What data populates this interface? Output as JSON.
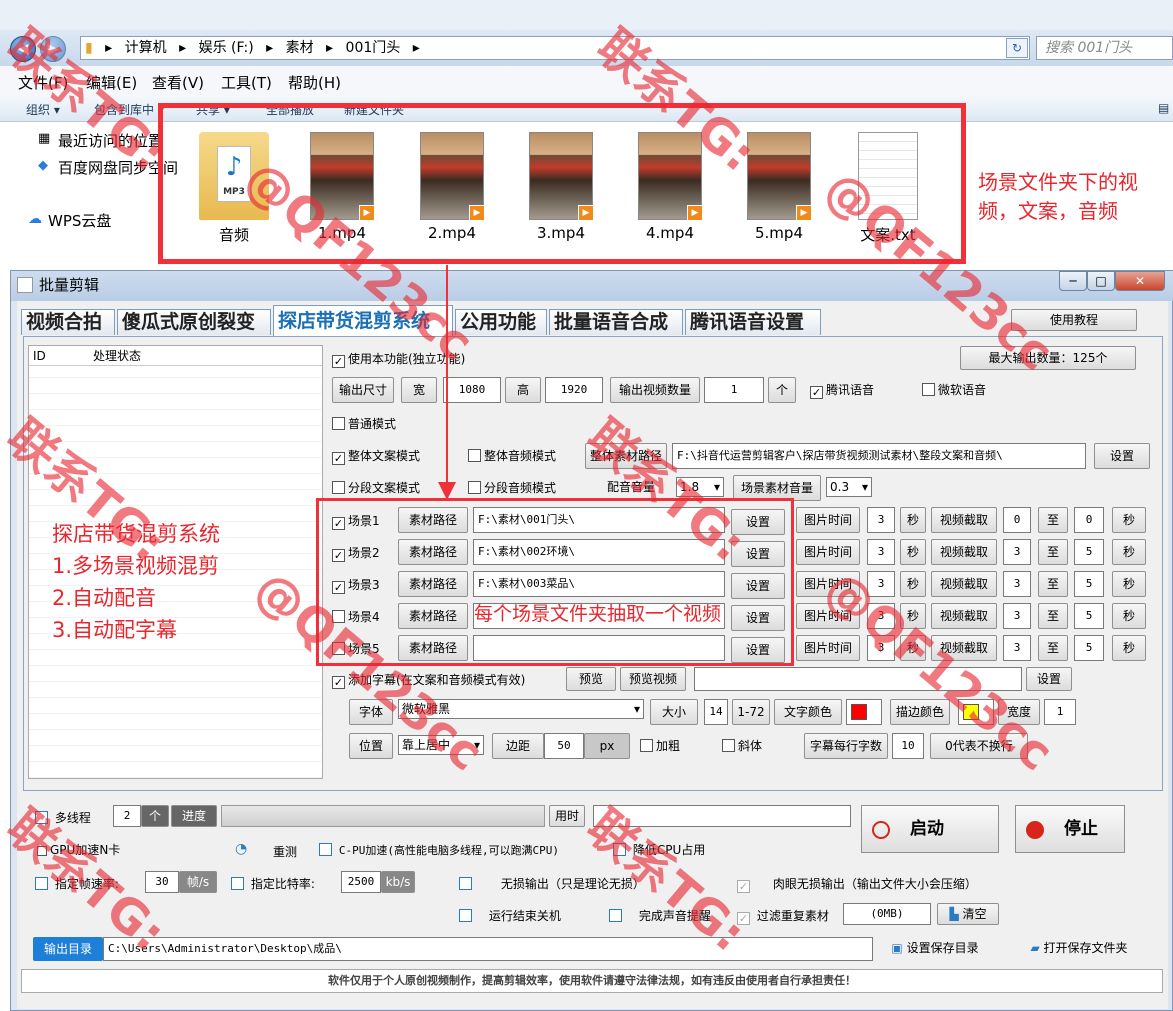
{
  "explorer": {
    "path": [
      "计算机",
      "娱乐 (F:)",
      "素材",
      "001门头"
    ],
    "search_placeholder": "搜索 001门头",
    "menu": [
      "文件(F)",
      "编辑(E)",
      "查看(V)",
      "工具(T)",
      "帮助(H)"
    ],
    "commands": [
      "组织 ▾",
      "包含到库中 ▾",
      "共享 ▾",
      "全部播放",
      "新建文件夹"
    ],
    "nav": [
      "最近访问的位置",
      "百度网盘同步空间",
      "WPS云盘"
    ],
    "files": [
      "音频",
      "1.mp4",
      "2.mp4",
      "3.mp4",
      "4.mp4",
      "5.mp4",
      "文案.txt"
    ],
    "mp3_label": "MP3"
  },
  "annotations": {
    "top": "场景文件夹下的视频，文案，音频",
    "left": [
      "探店带货混剪系统",
      "1.多场景视频混剪",
      "2.自动配音",
      "3.自动配字幕"
    ],
    "middle": "每个场景文件夹抽取一个视频"
  },
  "window": {
    "title": "批量剪辑",
    "tabs": [
      "视频合拍",
      "傻瓜式原创裂变",
      "探店带货混剪系统",
      "公用功能",
      "批量语音合成",
      "腾讯语音设置"
    ],
    "tutorial": "使用教程",
    "grid_headers": [
      "ID",
      "处理状态"
    ],
    "use_function": "使用本功能(独立功能)",
    "max_output": "最大输出数量：125个",
    "size_label": "输出尺寸",
    "width_label": "宽",
    "width": "1080",
    "height_label": "高",
    "height": "1920",
    "count_label": "输出视频数量",
    "count": "1",
    "count_unit": "个",
    "tencent_voice": "腾讯语音",
    "ms_voice": "微软语音",
    "normal_mode": "普通模式",
    "whole_text": "整体文案模式",
    "whole_audio": "整体音频模式",
    "whole_path_btn": "整体素材路径",
    "whole_path": "F:\\抖音代运营剪辑客户\\探店带货视频测试素材\\整段文案和音频\\",
    "set": "设置",
    "seg_text": "分段文案模式",
    "seg_audio": "分段音频模式",
    "dub_vol": "配音音量",
    "dub_vol_val": "1.8",
    "scene_vol": "场景素材音量",
    "scene_vol_val": "0.3",
    "scenes": [
      {
        "name": "场景1",
        "path": "F:\\素材\\001门头\\",
        "s1": "0",
        "s2": "0"
      },
      {
        "name": "场景2",
        "path": "F:\\素材\\002环境\\",
        "s1": "3",
        "s2": "5"
      },
      {
        "name": "场景3",
        "path": "F:\\素材\\003菜品\\",
        "s1": "3",
        "s2": "5"
      },
      {
        "name": "场景4",
        "path": "",
        "s1": "3",
        "s2": "5"
      },
      {
        "name": "场景5",
        "path": "",
        "s1": "3",
        "s2": "5"
      }
    ],
    "mat_path": "素材路径",
    "pic_time": "图片时间",
    "pic_val": "3",
    "sec": "秒",
    "clip": "视频截取",
    "to": "至",
    "subtitle": "添加字幕(在文案和音频模式有效)",
    "preview": "预览",
    "preview_video": "预览视频",
    "font_btn": "字体",
    "font": "微软雅黑",
    "size_btn": "大小",
    "size_val": "14",
    "size_range": "1-72",
    "text_color": "文字颜色",
    "stroke_color": "描边颜色",
    "stroke_width": "宽度",
    "stroke_width_val": "1",
    "text_color_hex": "#ff0000",
    "stroke_color_hex": "#ffff00",
    "pos_btn": "位置",
    "pos": "靠上居中",
    "margin": "边距",
    "margin_val": "50",
    "px": "px",
    "bold": "加粗",
    "italic": "斜体",
    "per_line": "字幕每行字数",
    "per_line_val": "10",
    "per_line_note": "0代表不换行",
    "multi": "多线程",
    "threads": "2",
    "thread_unit": "个",
    "progress": "进度",
    "elapsed": "用时",
    "start": "启动",
    "stop": "停止",
    "gpu": "GPU加速N卡",
    "recheck": "重测",
    "cpu": "C-PU加速(高性能电脑多线程,可以跑满CPU)",
    "low_cpu": "降低CPU占用",
    "fps_label": "指定帧速率:",
    "fps": "30",
    "fps_unit": "帧/s",
    "br_label": "指定比特率:",
    "br": "2500",
    "br_unit": "kb/s",
    "lossless": "无损输出（只是理论无损）",
    "eye_lossless": "肉眼无损输出（输出文件大小会压缩）",
    "shutdown": "运行结束关机",
    "sound": "完成声音提醒",
    "filter": "过滤重复素材",
    "filter_size": "(0MB)",
    "clear": "清空",
    "out_dir_label": "输出目录",
    "out_dir": "C:\\Users\\Administrator\\Desktop\\成品\\",
    "set_dir": "设置保存目录",
    "open_dir": "打开保存文件夹",
    "footer": "软件仅用于个人原创视频制作，提高剪辑效率，使用软件请遵守法律法规，如有违反由使用者自行承担责任！"
  },
  "watermarks": [
    "联系TG:",
    "@QF123cc"
  ]
}
